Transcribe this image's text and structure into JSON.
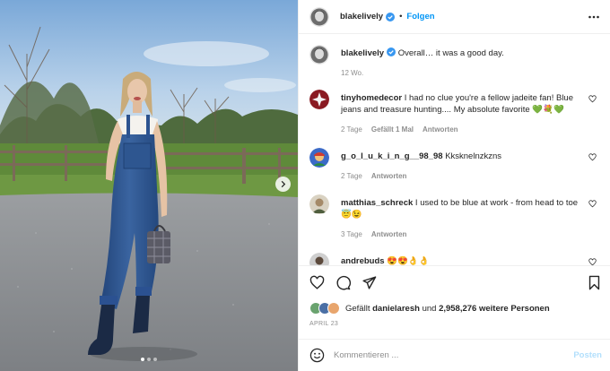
{
  "post": {
    "username": "blakelively",
    "follow_label": "Folgen",
    "separator": "•"
  },
  "caption": {
    "username": "blakelively",
    "text": "Overall… it was a good day.",
    "age": "12 Wo."
  },
  "comments": [
    {
      "username": "tinyhomedecor",
      "text": "I had no clue you're a fellow jadeite fan! Blue jeans and treasure hunting.... My absolute favorite 💚💐💚",
      "age": "2 Tage",
      "likes": "Gefällt 1 Mal",
      "reply": "Antworten"
    },
    {
      "username": "g_o_l_u_k_i_n_g__98_98",
      "text": "Kksknelnzkzns",
      "age": "2 Tage",
      "reply": "Antworten"
    },
    {
      "username": "matthias_schreck",
      "text": "I used to be blue at work - from head to toe😇😉",
      "age": "3 Tage",
      "reply": "Antworten"
    },
    {
      "username": "andrebuds",
      "text": "😍😍👌👌"
    }
  ],
  "likes": {
    "prefix": "Gefällt",
    "user": "danielaresh",
    "connector": "und",
    "count_text": "2,958,276 weitere Personen"
  },
  "date": "APRIL 23",
  "comment_box": {
    "placeholder": "Kommentieren ...",
    "post_label": "Posten"
  },
  "carousel": {
    "slide_count": 3,
    "active_slide": 1
  },
  "colors": {
    "link_blue": "#0095f6",
    "post_disabled": "#b2dffc",
    "verified": "#3897f0",
    "muted": "#8e8e8e",
    "divider": "#efefef"
  },
  "icons": [
    "verified-badge-icon",
    "more-options-icon",
    "heart-icon",
    "comment-icon",
    "share-icon",
    "bookmark-icon",
    "emoji-icon",
    "chevron-right-icon"
  ]
}
